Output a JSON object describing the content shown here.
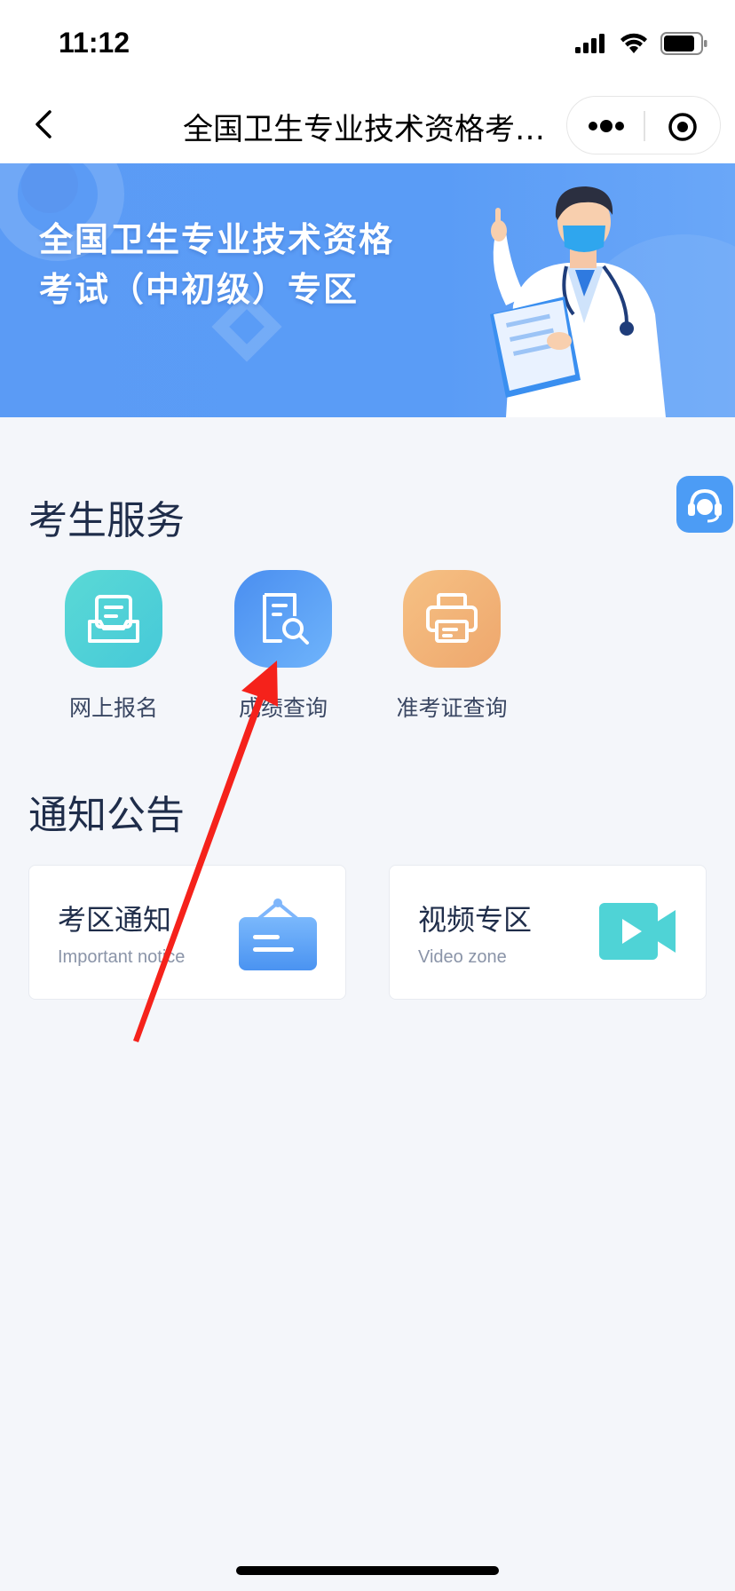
{
  "status_bar": {
    "time": "11:12"
  },
  "nav": {
    "title": "全国卫生专业技术资格考…",
    "back_icon": "chevron-left-icon",
    "more_icon": "more-dots-icon",
    "close_icon": "target-circle-icon"
  },
  "banner": {
    "title_line1": "全国卫生专业技术资格",
    "title_line2": "考试（中初级）专区"
  },
  "services": {
    "section_title": "考生服务",
    "items": [
      {
        "label": "网上报名",
        "icon": "inbox-form-icon",
        "color": "#4fd3d6"
      },
      {
        "label": "成绩查询",
        "icon": "document-search-icon",
        "color": "#4a90f0"
      },
      {
        "label": "准考证查询",
        "icon": "printer-icon",
        "color": "#f0b37a"
      }
    ]
  },
  "notices": {
    "section_title": "通知公告",
    "cards": [
      {
        "title": "考区通知",
        "subtitle": "Important notice",
        "icon": "hanging-sign-icon"
      },
      {
        "title": "视频专区",
        "subtitle": "Video zone",
        "icon": "video-camera-icon"
      }
    ]
  },
  "float_button": {
    "icon": "customer-service-headset-icon"
  },
  "colors": {
    "banner_blue": "#5b9bf5",
    "annotation_arrow": "#f5221b",
    "text_dark": "#1f2d4a"
  }
}
